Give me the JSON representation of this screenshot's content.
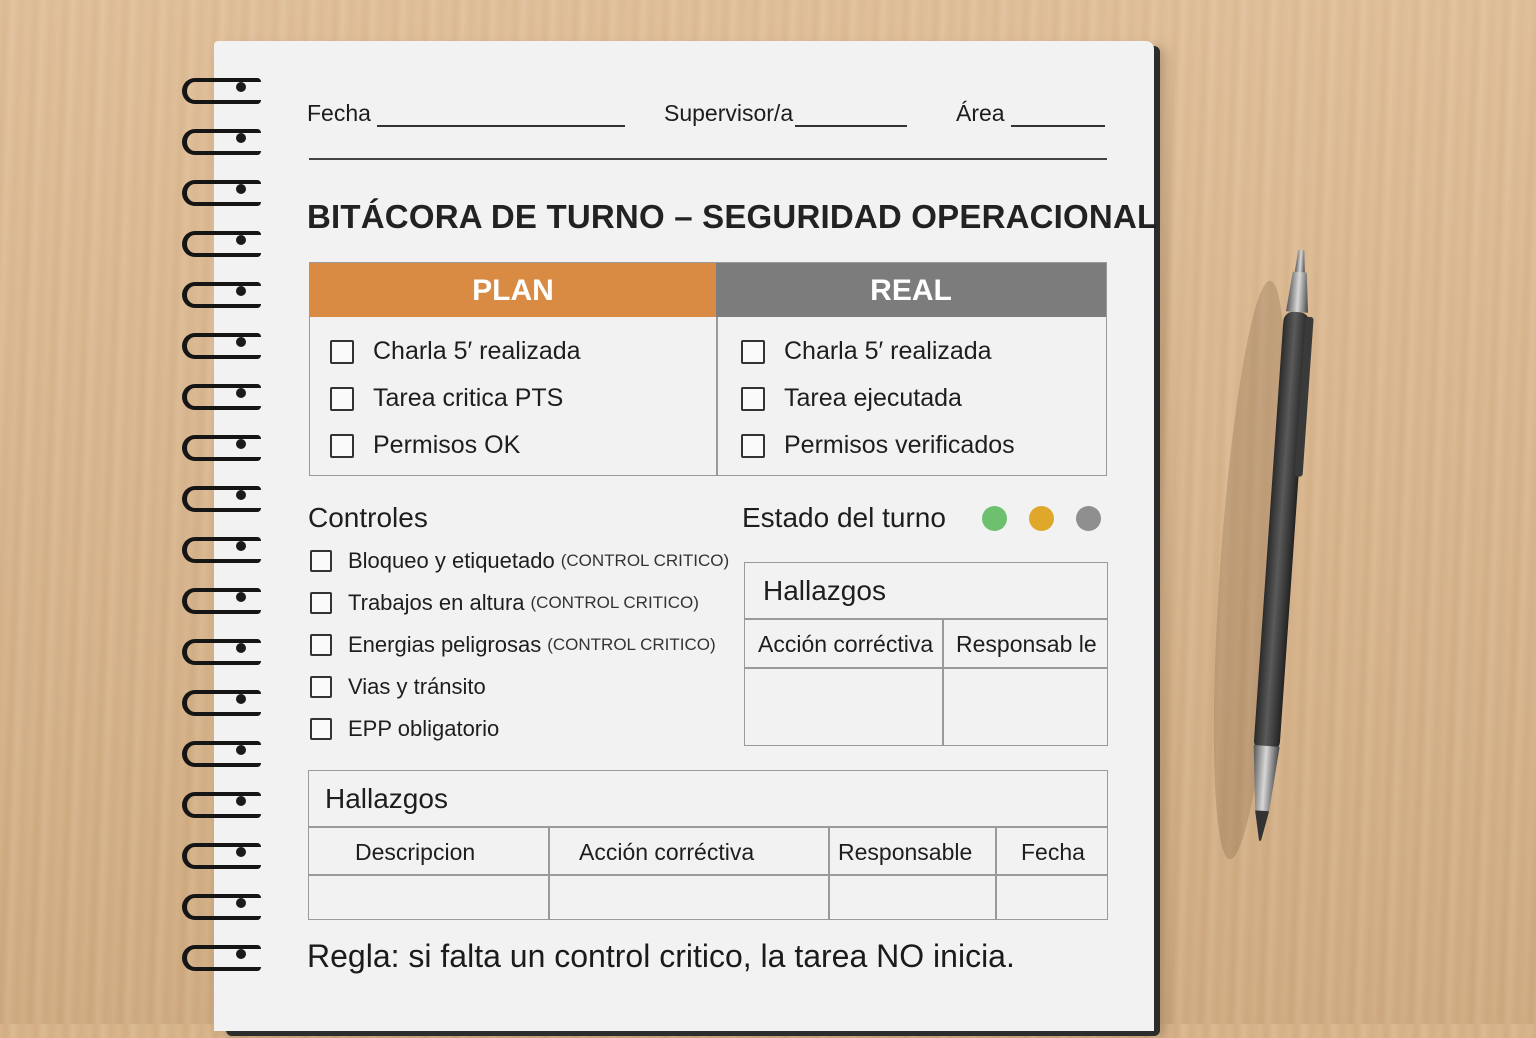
{
  "header": {
    "fecha_label": "Fecha",
    "supervisor_label": "Supervisor/a",
    "area_label": "Área"
  },
  "title": "BITÁCORA DE TURNO – SEGURIDAD OPERACIONAL",
  "plan_real": {
    "plan_label": "PLAN",
    "real_label": "REAL",
    "plan_color": "#d98b43",
    "real_color": "#7c7c7c",
    "plan_items": [
      "Charla 5′ realizada",
      "Tarea critica PTS",
      "Permisos OK"
    ],
    "real_items": [
      "Charla 5′ realizada",
      "Tarea ejecutada",
      "Permisos verificados"
    ]
  },
  "controles": {
    "title": "Controles",
    "items": [
      {
        "label": "Bloqueo y etiquetado",
        "note": "(CONTROL CRITICO)"
      },
      {
        "label": "Trabajos en altura",
        "note": "(CONTROL CRITICO)"
      },
      {
        "label": "Energias peligrosas",
        "note": "(CONTROL CRITICO)"
      },
      {
        "label": "Vias y tránsito",
        "note": ""
      },
      {
        "label": "EPP obligatorio",
        "note": ""
      }
    ]
  },
  "estado": {
    "title": "Estado del turno",
    "colors": [
      "#6cc06e",
      "#e0a82a",
      "#8f8f8f"
    ]
  },
  "hallazgos_small": {
    "title": "Hallazgos",
    "columns": [
      "Acción corréctiva",
      "Responsab le"
    ]
  },
  "hallazgos_big": {
    "title": "Hallazgos",
    "columns": [
      "Descripcion",
      "Acción corréctiva",
      "Responsable",
      "Fecha"
    ]
  },
  "rule_text": "Regla: si falta un control critico, la tarea NO inicia."
}
